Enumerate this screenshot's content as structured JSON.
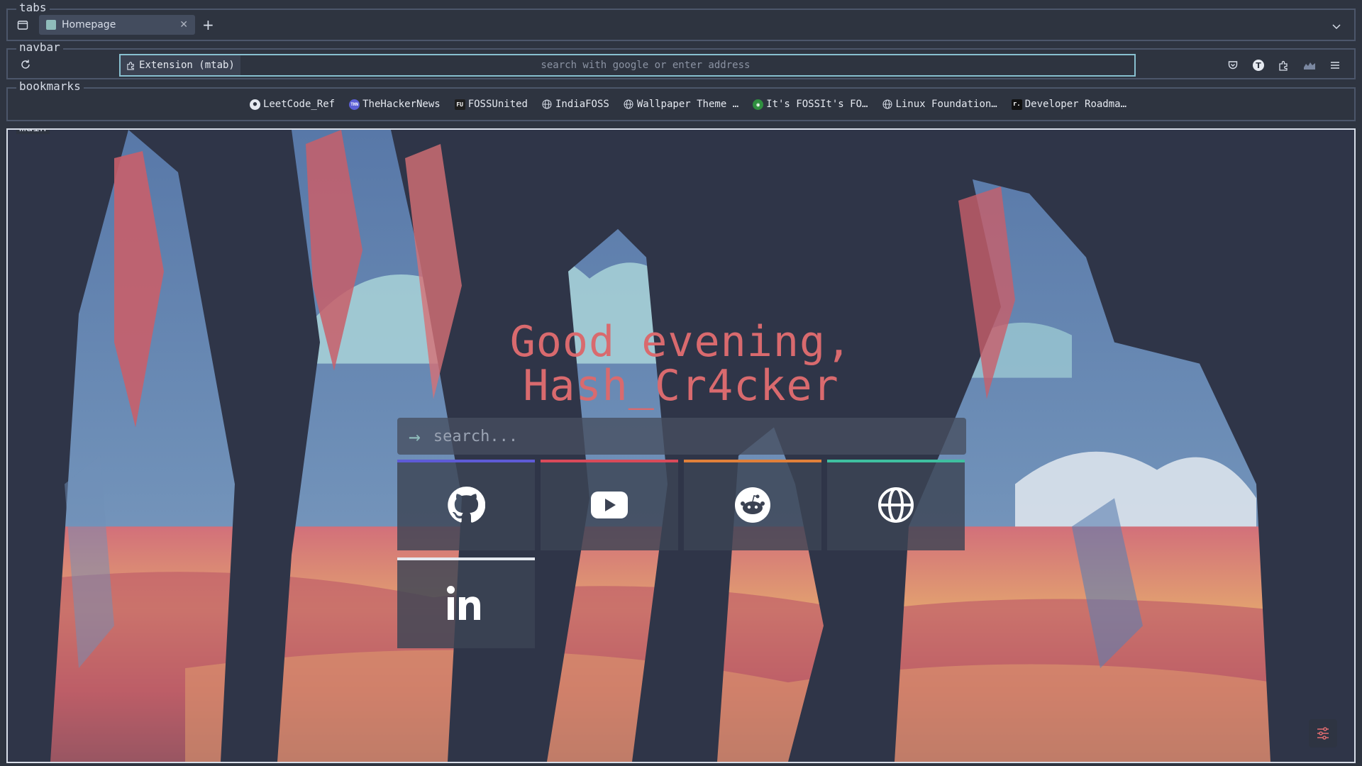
{
  "sections": {
    "tabs": "tabs",
    "navbar": "navbar",
    "bookmarks": "bookmarks",
    "main": "main"
  },
  "tabs": [
    {
      "title": "Homepage",
      "active": true
    }
  ],
  "navbar": {
    "extension_label": "Extension (mtab)",
    "url_placeholder": "search with google or enter address"
  },
  "bookmarks": [
    {
      "label": "LeetCode_Ref",
      "icon": "leetcode-icon"
    },
    {
      "label": "TheHackerNews",
      "icon": "thehackernews-icon"
    },
    {
      "label": "FOSSUnited",
      "icon": "fossunited-icon"
    },
    {
      "label": "IndiaFOSS",
      "icon": "globe-icon"
    },
    {
      "label": "Wallpaper Theme …",
      "icon": "globe-icon"
    },
    {
      "label": "It's FOSSIt's FO…",
      "icon": "itsfoss-icon"
    },
    {
      "label": "Linux Foundation…",
      "icon": "globe-icon"
    },
    {
      "label": "Developer Roadma…",
      "icon": "roadmap-icon"
    }
  ],
  "main": {
    "greeting_line1": "Good evening,",
    "greeting_line2": "Hash_Cr4cker",
    "search_placeholder": "search...",
    "quick_links": [
      {
        "name": "github",
        "icon": "github-icon",
        "accent": "#5e5bd6"
      },
      {
        "name": "youtube",
        "icon": "youtube-icon",
        "accent": "#d94a5a"
      },
      {
        "name": "reddit",
        "icon": "reddit-icon",
        "accent": "#e0803a"
      },
      {
        "name": "website",
        "icon": "globe-icon",
        "accent": "#3fbfa0"
      },
      {
        "name": "linkedin",
        "icon": "linkedin-icon",
        "accent": "#e5e9f0"
      }
    ]
  },
  "colors": {
    "background": "#2e3440",
    "frame": "#4c566a",
    "greeting": "#d96a6e",
    "url_border": "#88c0d0"
  }
}
